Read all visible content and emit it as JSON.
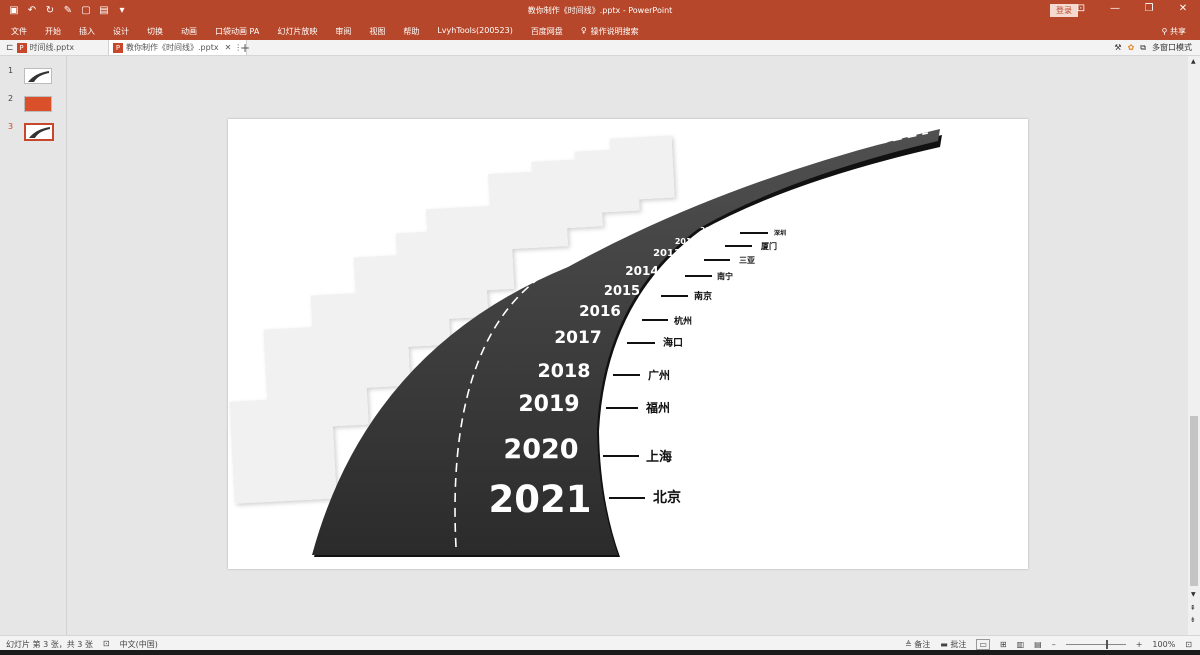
{
  "window": {
    "title": "教你制作《时间线》.pptx - PowerPoint",
    "login_label": "登录"
  },
  "ribbon": {
    "tabs": [
      "文件",
      "开始",
      "插入",
      "设计",
      "切换",
      "动画",
      "口袋动画 PA",
      "幻灯片放映",
      "审阅",
      "视图",
      "帮助",
      "LvyhTools(200523)",
      "百度网盘",
      "操作说明搜索"
    ],
    "share_label": "共享"
  },
  "doc_tabs": [
    {
      "label": "时间线.pptx",
      "active": false
    },
    {
      "label": "教你制作《时间线》.pptx",
      "active": true
    }
  ],
  "multi_window_label": "多窗口模式",
  "thumbnails": [
    {
      "number": "1",
      "selected": false
    },
    {
      "number": "2",
      "selected": false
    },
    {
      "number": "3",
      "selected": true
    }
  ],
  "slide": {
    "timeline": [
      {
        "year": "2011",
        "city": "深圳"
      },
      {
        "year": "2012",
        "city": "厦门"
      },
      {
        "year": "2013",
        "city": "三亚"
      },
      {
        "year": "2014",
        "city": "南宁"
      },
      {
        "year": "2015",
        "city": "南京"
      },
      {
        "year": "2016",
        "city": "杭州"
      },
      {
        "year": "2017",
        "city": "海口"
      },
      {
        "year": "2018",
        "city": "广州"
      },
      {
        "year": "2019",
        "city": "福州"
      },
      {
        "year": "2020",
        "city": "上海"
      },
      {
        "year": "2021",
        "city": "北京"
      }
    ],
    "road_color": "#3d3d3d",
    "placeholder_color": "#f1f1f1"
  },
  "status": {
    "slide_info": "幻灯片 第 3 张，共 3 张",
    "language": "中文(中国)",
    "notes_label": "备注",
    "comments_label": "批注",
    "zoom": "100%"
  },
  "colors": {
    "accent": "#b7472a"
  }
}
